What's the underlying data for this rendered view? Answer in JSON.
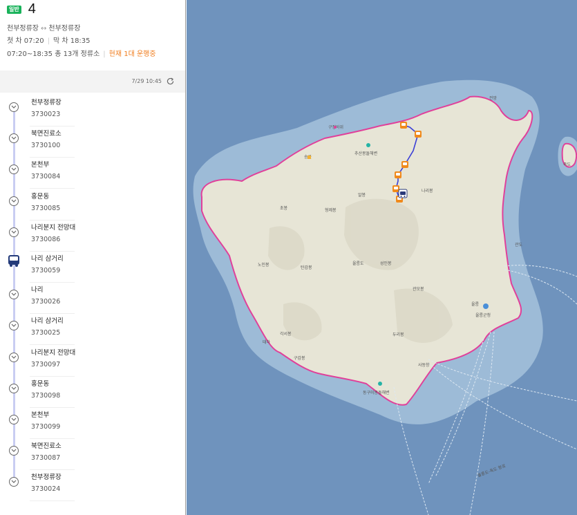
{
  "route": {
    "badge": "일반",
    "number": "4",
    "start_stop": "천부정류장",
    "direction_icon": "bidirectional-arrow-icon",
    "direction_arrow": "↔",
    "end_stop": "천부정류장",
    "first_bus": "첫 차 07:20",
    "last_bus": "막 차 18:35",
    "summary": "07:20~18:35 총 13개 정류소",
    "live_status": "현재 1대 운행중"
  },
  "refresh": {
    "time": "7/29 10:45",
    "icon": "refresh-icon"
  },
  "stops": [
    {
      "name": "천부정류장",
      "id": "3730023"
    },
    {
      "name": "북면진료소",
      "id": "3730100"
    },
    {
      "name": "본천부",
      "id": "3730084"
    },
    {
      "name": "홍문동",
      "id": "3730085"
    },
    {
      "name": "나리분지 전망대",
      "id": "3730086"
    },
    {
      "name": "나리 삼거리",
      "id": "3730059"
    },
    {
      "name": "나리",
      "id": "3730026"
    },
    {
      "name": "나리 삼거리",
      "id": "3730025"
    },
    {
      "name": "나리분지 전망대",
      "id": "3730097"
    },
    {
      "name": "홍문동",
      "id": "3730098"
    },
    {
      "name": "본천부",
      "id": "3730099"
    },
    {
      "name": "북면진료소",
      "id": "3730087"
    },
    {
      "name": "천부정류장",
      "id": "3730024"
    }
  ],
  "current_bus_stop_index": 5,
  "colors": {
    "badge": "#19b25a",
    "live": "#f07d1e",
    "route_line": "#3b3fd6",
    "stop_marker": "#f08a1c",
    "sea": "#6f93bd",
    "shallow": "#9dbbd7",
    "land": "#e7e5d6",
    "coast": "#e0409a"
  },
  "map": {
    "labels": {
      "jeonmang": "전망",
      "gujeong": "구정바위",
      "chusan": "추산몽돌해변",
      "songgot": "송곳",
      "albong": "알봉",
      "narabong": "나리봉",
      "chobong": "초봉",
      "hyeongjebong": "형제봉",
      "noinbong": "노인봉",
      "tanbong": "탄감봉",
      "ulleungdo": "울릉도",
      "seonginbong": "성인봉",
      "gwanmobong": "관모봉",
      "jukdo": "죽도",
      "gwando": "관도",
      "ulleunggun": "울릉군청",
      "ulleung_short": "울릉",
      "gakseobong": "각서봉",
      "durubong": "두리봉",
      "taeha": "태하",
      "gugambong": "구감봉",
      "sadong": "사동항",
      "namyang": "남양",
      "namyang_beach": "동구미몽돌해변",
      "ferry_route": "울릉도-독도 항로"
    }
  }
}
